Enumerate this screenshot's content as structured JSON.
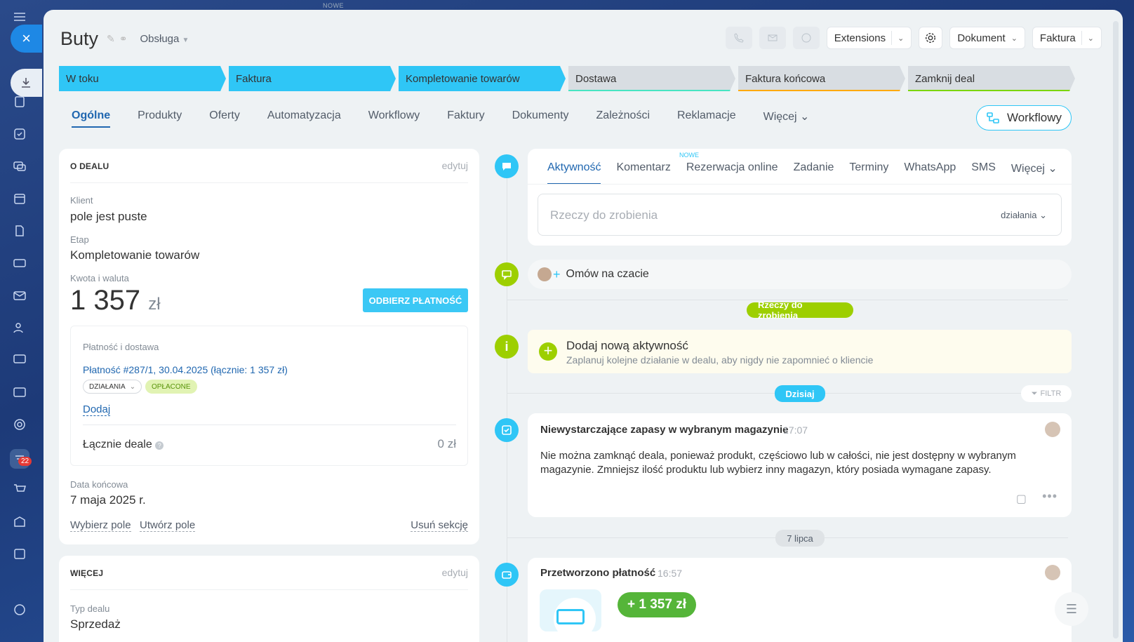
{
  "topbar": {
    "nowe": "NOWE"
  },
  "sidebar": {
    "close_icon": "×",
    "badge": "22"
  },
  "header": {
    "title": "Buty",
    "category": "Obsługa",
    "extensions": "Extensions",
    "dokument": "Dokument",
    "faktura": "Faktura"
  },
  "stages": [
    {
      "label": "W toku",
      "color": "#2fc6f6",
      "underline": "#2fc6f6"
    },
    {
      "label": "Faktura",
      "color": "#2fc6f6",
      "underline": "#2fc6f6"
    },
    {
      "label": "Kompletowanie towarów",
      "color": "#2fc6f6",
      "underline": "#2fc6f6"
    },
    {
      "label": "Dostawa",
      "color": "#d8dde2",
      "underline": "#47e4c2"
    },
    {
      "label": "Faktura końcowa",
      "color": "#d8dde2",
      "underline": "#ffa900"
    },
    {
      "label": "Zamknij deal",
      "color": "#d8dde2",
      "underline": "#7bd500"
    }
  ],
  "tabs": [
    "Ogólne",
    "Produkty",
    "Oferty",
    "Automatyzacja",
    "Workflowy",
    "Faktury",
    "Dokumenty",
    "Zależności",
    "Reklamacje",
    "Więcej"
  ],
  "workflow_button": "Workflowy",
  "about": {
    "title": "O DEALU",
    "edit": "edytuj",
    "client_label": "Klient",
    "client_value": "pole jest puste",
    "stage_label": "Etap",
    "stage_value": "Kompletowanie towarów",
    "amount_label": "Kwota i waluta",
    "amount": "1 357",
    "currency": "zł",
    "pay_button": "ODBIERZ PŁATNOŚĆ",
    "payment_title": "Płatność i dostawa",
    "payment_link": "Płatność #287/1, 30.04.2025 (łącznie: 1 357 zł)",
    "actions_badge": "DZIAŁANIA",
    "paid_badge": "OPŁACONE",
    "add": "Dodaj",
    "total_label": "Łącznie deale",
    "total_value": "0 zł",
    "end_label": "Data końcowa",
    "end_value": "7 maja 2025 r.",
    "select_field": "Wybierz pole",
    "create_field": "Utwórz pole",
    "delete_section": "Usuń sekcję"
  },
  "more": {
    "title": "WIĘCEJ",
    "edit": "edytuj",
    "type_label": "Typ dealu",
    "type_value": "Sprzedaż"
  },
  "activity": {
    "nowe": "NOWE",
    "tabs": [
      "Aktywność",
      "Komentarz",
      "Rezerwacja online",
      "Zadanie",
      "Terminy",
      "WhatsApp",
      "SMS",
      "Więcej"
    ],
    "input_placeholder": "Rzeczy do zrobienia",
    "actions": "działania",
    "chat": "Omów na czacie",
    "todo_pill": "Rzeczy do zrobienia",
    "add_title": "Dodaj nową aktywność",
    "add_sub": "Zaplanuj kolejne działanie w dealu, aby nigdy nie zapomnieć o kliencie",
    "today_pill": "Dzisiaj",
    "filter": "FILTR",
    "event1_title": "Niewystarczające zapasy w wybranym magazynie",
    "event1_time": "17:07",
    "event1_body": "Nie można zamknąć deala, ponieważ produkt, częściowo lub w całości, nie jest dostępny w wybranym magazynie. Zmniejsz ilość produktu lub wybierz inny magazyn, który posiada wymagane zapasy.",
    "date_pill": "7 lipca",
    "event2_title": "Przetworzono płatność",
    "event2_time": "16:57",
    "event2_amount": "+ 1 357 zł"
  }
}
